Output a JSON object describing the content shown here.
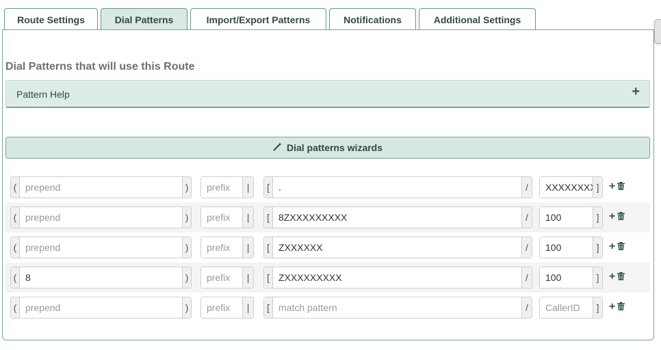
{
  "tabs": [
    {
      "label": "Route Settings",
      "active": false
    },
    {
      "label": "Dial Patterns",
      "active": true
    },
    {
      "label": "Import/Export Patterns",
      "active": false
    },
    {
      "label": "Notifications",
      "active": false
    },
    {
      "label": "Additional Settings",
      "active": false
    }
  ],
  "section_title": "Dial Patterns that will use this Route",
  "help": {
    "label": "Pattern Help",
    "toggle": "+"
  },
  "wizard": {
    "icon": "magic-wand-icon",
    "label": "Dial patterns wizards"
  },
  "pattern_placeholders": {
    "prepend": "prepend",
    "prefix": "prefix",
    "match": "match pattern",
    "callerid": "CallerID"
  },
  "patterns": [
    {
      "prepend": "",
      "prefix": "",
      "match": ".",
      "callerid": "XXXXXXXXXX"
    },
    {
      "prepend": "",
      "prefix": "",
      "match": "8ZXXXXXXXXX",
      "callerid": "100"
    },
    {
      "prepend": "",
      "prefix": "",
      "match": "ZXXXXXX",
      "callerid": "100"
    },
    {
      "prepend": "8",
      "prefix": "",
      "match": "ZXXXXXXXXX",
      "callerid": "100"
    },
    {
      "prepend": "",
      "prefix": "",
      "match": "",
      "callerid": ""
    }
  ],
  "brackets": {
    "open_paren": "(",
    "close_paren": ")",
    "pipe": "|",
    "open_bracket": "[",
    "slash": "/",
    "close_bracket": "]"
  },
  "colors": {
    "accent": "#2f5a48",
    "border": "#7aa593",
    "tab_active_bg": "#dbe9e3"
  }
}
